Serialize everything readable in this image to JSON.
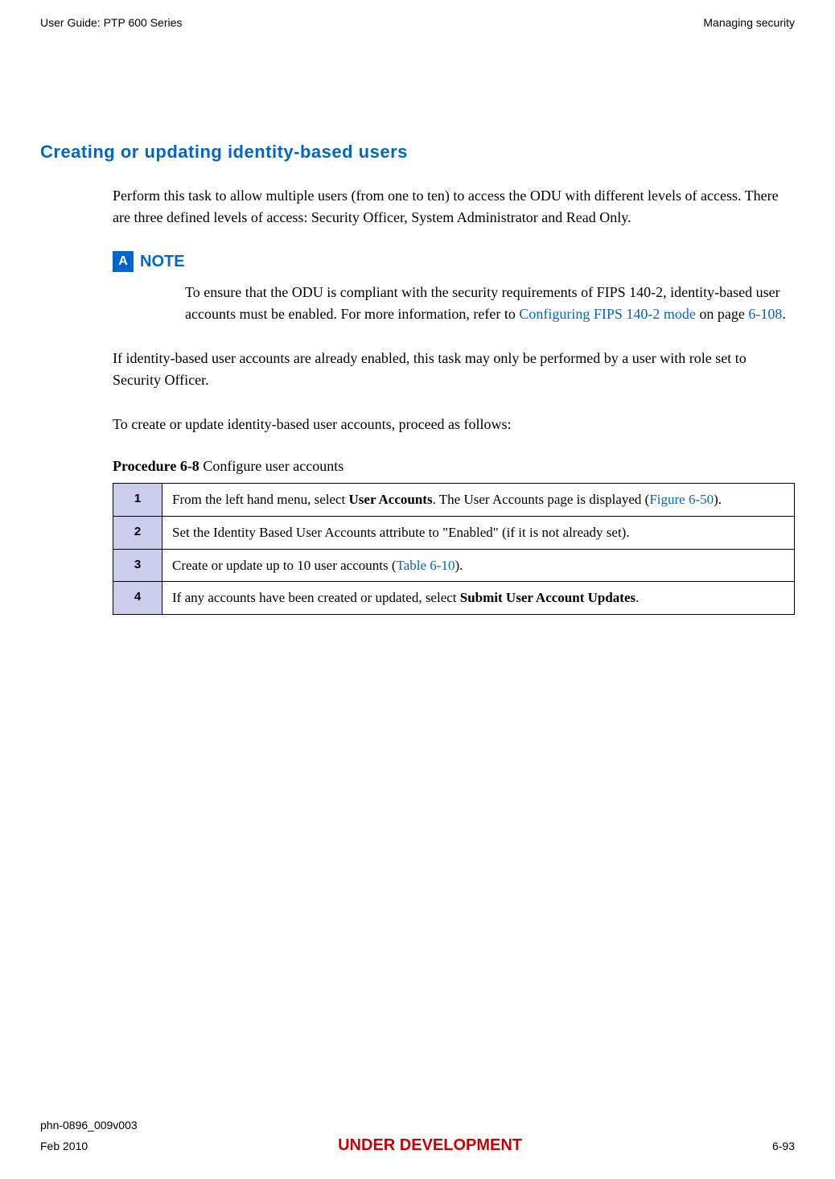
{
  "header": {
    "left": "User Guide: PTP 600 Series",
    "right": "Managing security"
  },
  "section_heading": "Creating or updating identity-based users",
  "intro": "Perform this task to allow multiple users (from one to ten) to access the ODU with different levels of access. There are three defined levels of access: Security Officer, System Administrator and Read Only.",
  "note": {
    "label": "NOTE",
    "icon_letter": "A",
    "text_prefix": "To ensure that the ODU is compliant with the security requirements of  FIPS 140-2, identity-based user accounts must be enabled. For more information, refer to ",
    "link1": "Configuring FIPS 140-2 mode",
    "mid": " on page ",
    "link2": "6-108",
    "suffix": "."
  },
  "para2": "If identity-based user accounts are already enabled, this task may only be performed by a user with role set to Security Officer.",
  "para3": "To create or update identity-based user accounts, proceed as follows:",
  "procedure": {
    "label_bold": "Procedure 6-8",
    "label_rest": "  Configure user accounts",
    "steps": [
      {
        "num": "1",
        "pre": "From the left hand menu, select ",
        "bold1": "User Accounts",
        "mid": ". The User Accounts page is displayed (",
        "link": "Figure 6-50",
        "post": ")."
      },
      {
        "num": "2",
        "text": "Set the Identity Based User Accounts attribute  to \"Enabled\" (if it is not already set)."
      },
      {
        "num": "3",
        "pre": "Create or update up to 10 user accounts (",
        "link": "Table 6-10",
        "post": ")."
      },
      {
        "num": "4",
        "pre": "If any accounts have been created or updated, select ",
        "bold1": "Submit User Account Updates",
        "post": "."
      }
    ]
  },
  "footer": {
    "doc_id": "phn-0896_009v003",
    "date": "Feb 2010",
    "status": "UNDER DEVELOPMENT",
    "page": "6-93"
  }
}
